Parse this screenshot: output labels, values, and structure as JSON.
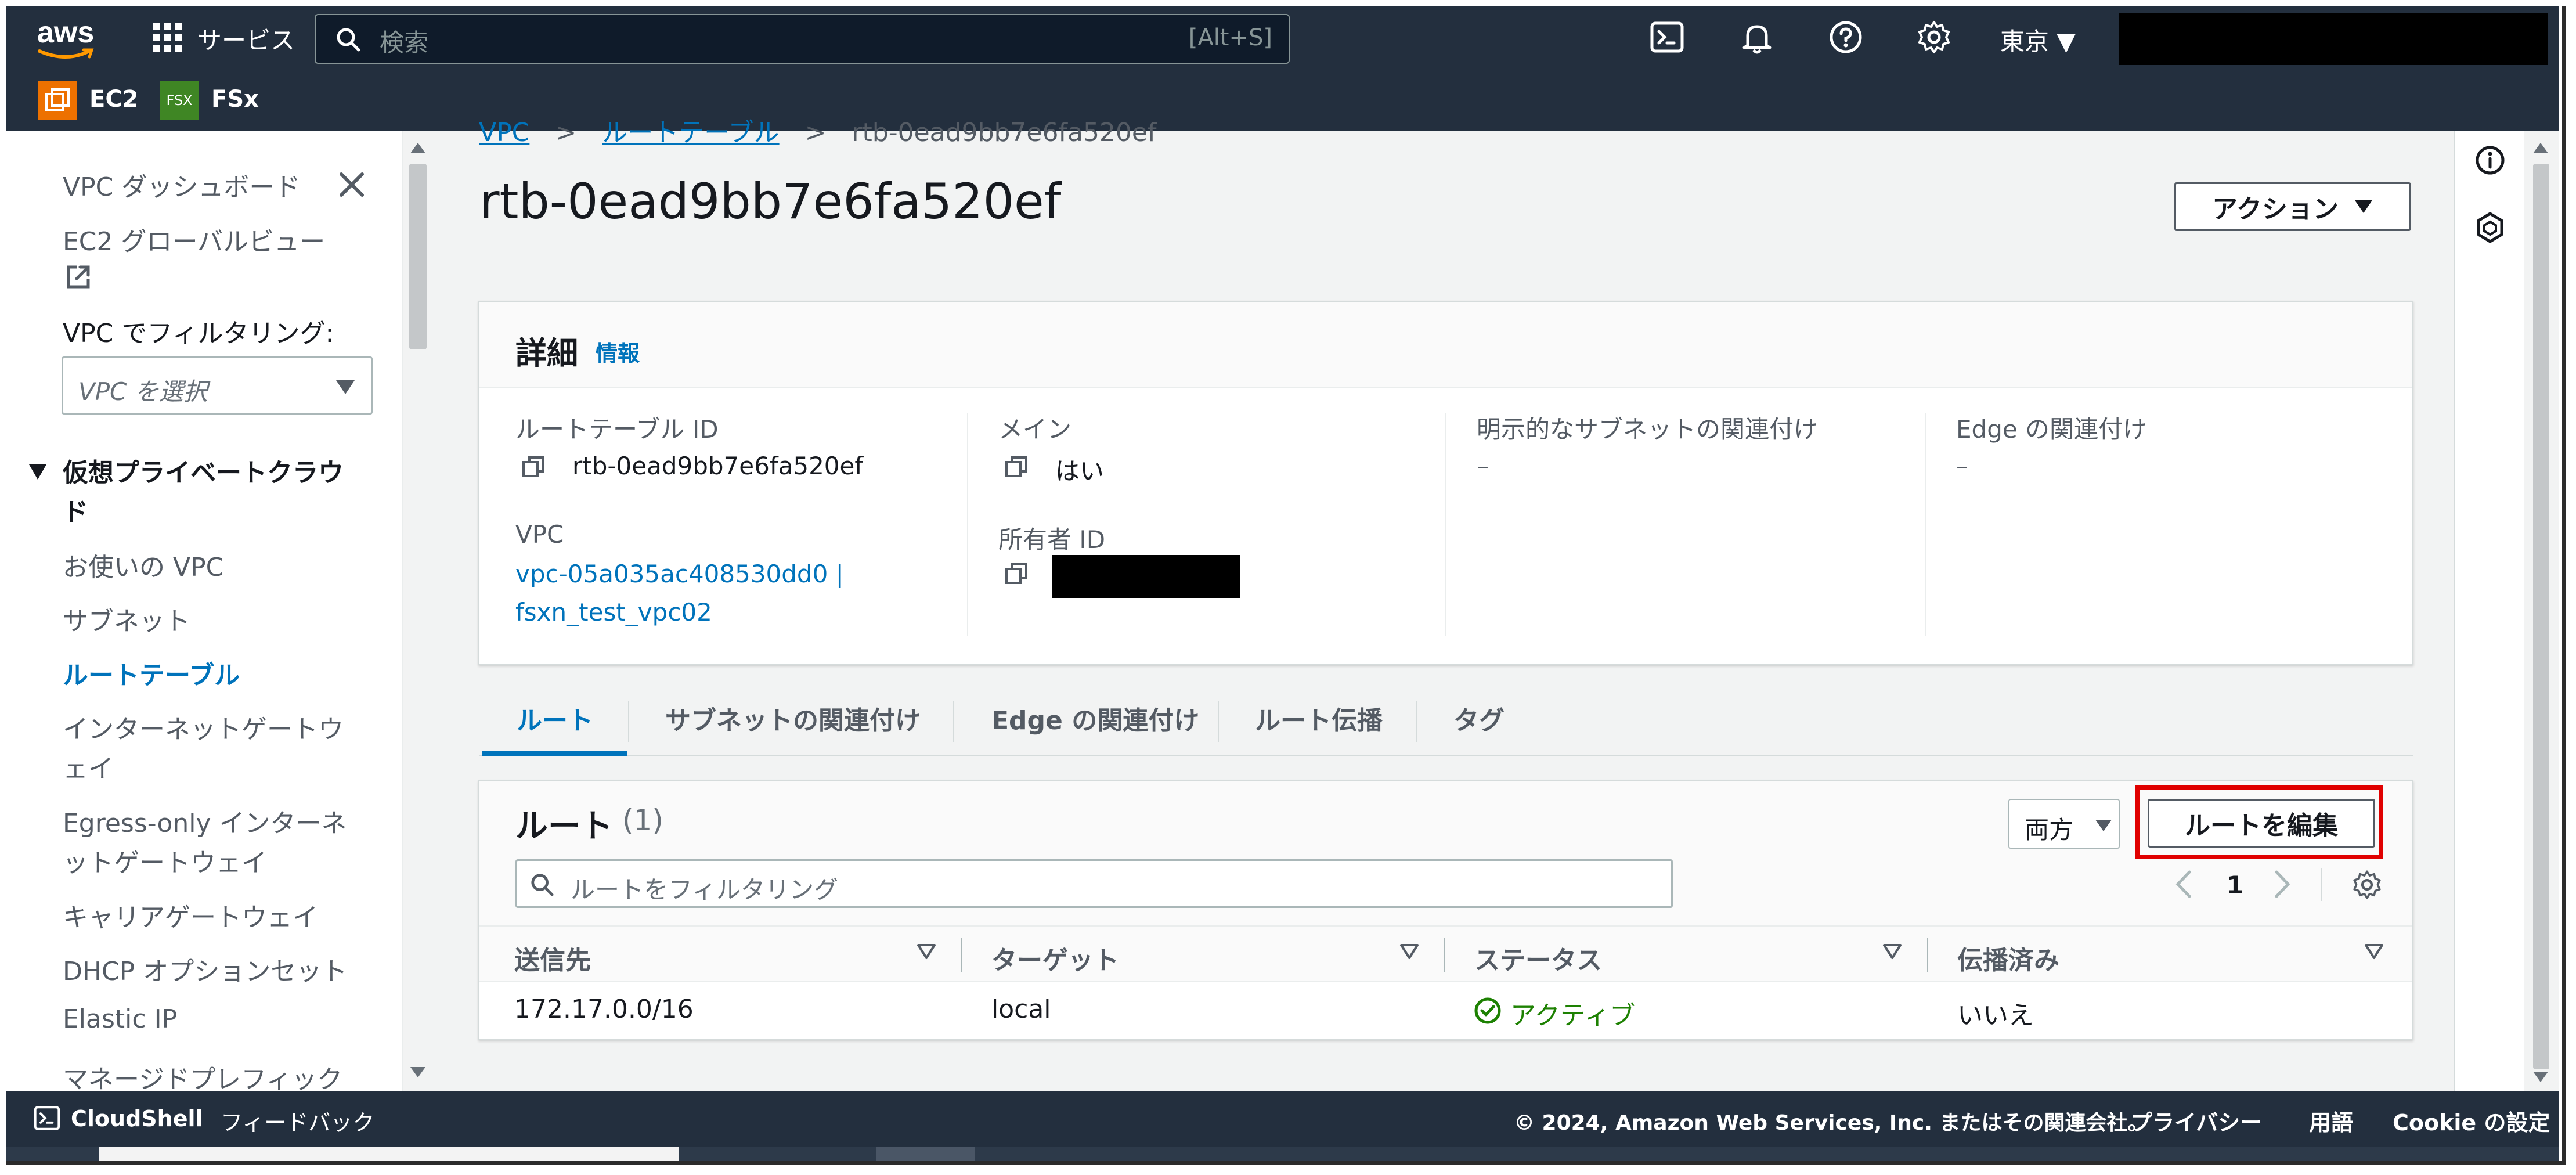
{
  "topbar": {
    "brand": "aws",
    "services_label": "サービス",
    "search_placeholder": "検索",
    "search_shortcut": "[Alt+S]",
    "region": "東京 ▼"
  },
  "favorites": [
    {
      "label": "EC2",
      "icon_text": ""
    },
    {
      "label": "FSx",
      "icon_text": "FSX"
    }
  ],
  "breadcrumb": {
    "items": [
      "VPC",
      "ルートテーブル",
      "rtb-0ead9bb7e6fa520ef"
    ]
  },
  "sidebar": {
    "dashboard": "VPC ダッシュボード",
    "global_view": "EC2 グローバルビュー",
    "filter_label": "VPC でフィルタリング:",
    "filter_placeholder": "VPC を選択",
    "section_title_line1": "仮想プライベートクラウ",
    "section_title_line2": "ド",
    "items": [
      {
        "label": "お使いの VPC"
      },
      {
        "label": "サブネット"
      },
      {
        "label": "ルートテーブル",
        "active": true
      },
      {
        "label_line1": "インターネットゲートウ",
        "label_line2": "ェイ"
      },
      {
        "label_line1": "Egress-only インターネ",
        "label_line2": "ットゲートウェイ"
      },
      {
        "label": "キャリアゲートウェイ"
      },
      {
        "label": "DHCP オプションセット"
      },
      {
        "label": "Elastic IP"
      },
      {
        "label": "マネージドプレフィック"
      }
    ]
  },
  "page": {
    "title": "rtb-0ead9bb7e6fa520ef",
    "actions_label": "アクション"
  },
  "details": {
    "heading": "詳細",
    "info_link": "情報",
    "route_table_id_label": "ルートテーブル ID",
    "route_table_id_value": "rtb-0ead9bb7e6fa520ef",
    "vpc_label": "VPC",
    "vpc_value_line1": "vpc-05a035ac408530dd0 |",
    "vpc_value_line2": "fsxn_test_vpc02",
    "main_label": "メイン",
    "main_value": "はい",
    "owner_label": "所有者 ID",
    "explicit_label": "明示的なサブネットの関連付け",
    "explicit_value": "–",
    "edge_label": "Edge の関連付け",
    "edge_value": "–"
  },
  "tabs": [
    {
      "label": "ルート",
      "active": true
    },
    {
      "label": "サブネットの関連付け"
    },
    {
      "label": "Edge の関連付け"
    },
    {
      "label": "ルート伝播"
    },
    {
      "label": "タグ"
    }
  ],
  "routes": {
    "heading": "ルート",
    "count": "(1)",
    "both_label": "両方",
    "edit_button": "ルートを編集",
    "filter_placeholder": "ルートをフィルタリング",
    "page_number": "1",
    "columns": [
      "送信先",
      "ターゲット",
      "ステータス",
      "伝播済み"
    ],
    "rows": [
      {
        "destination": "172.17.0.0/16",
        "target": "local",
        "status": "アクティブ",
        "propagated": "いいえ"
      }
    ]
  },
  "footer": {
    "cloudshell": "CloudShell",
    "feedback": "フィードバック",
    "copyright": "© 2024, Amazon Web Services, Inc. またはその関連会社。",
    "privacy": "プライバシー",
    "terms": "用語",
    "cookies": "Cookie の設定"
  },
  "colors": {
    "nav_bg": "#232f3e",
    "link": "#0073bb",
    "success": "#1d8102",
    "highlight": "#e00000",
    "brand_orange": "#ff9900"
  }
}
